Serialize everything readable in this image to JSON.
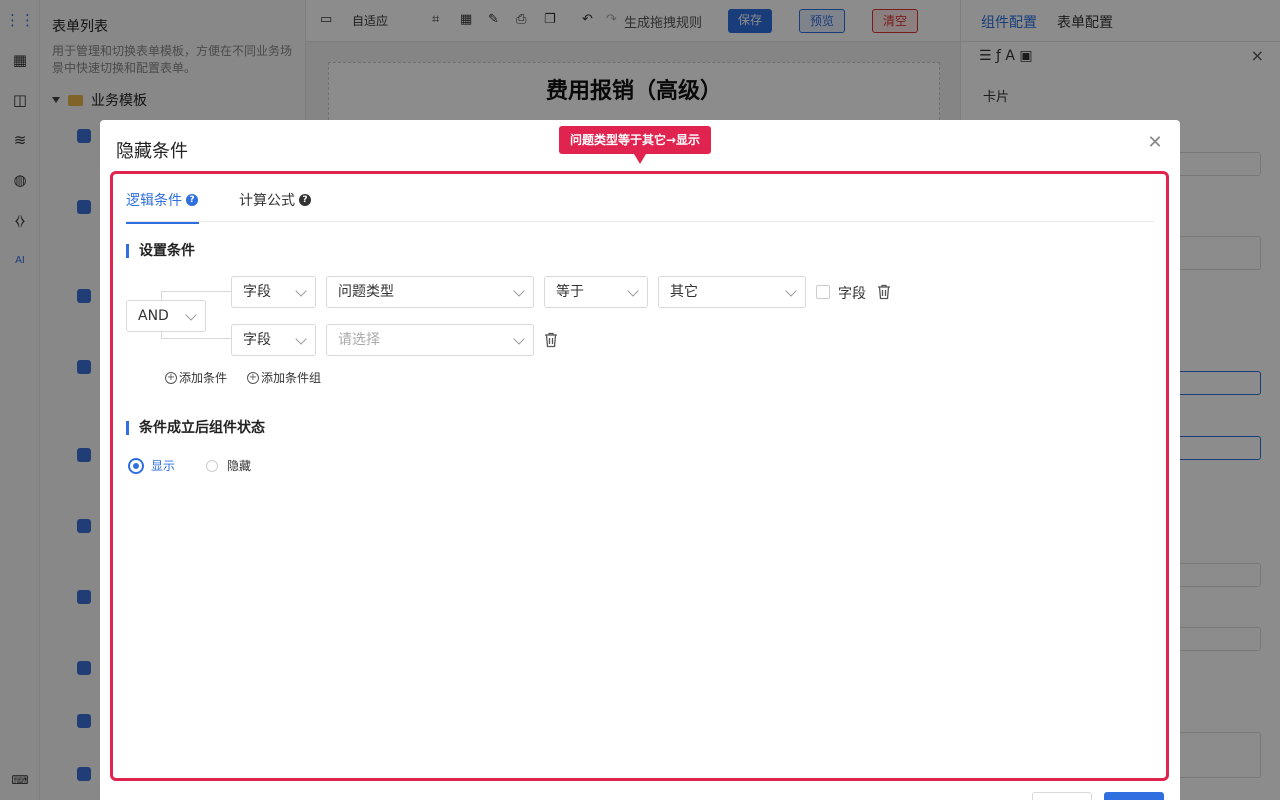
{
  "left_panel": {
    "title": "表单列表",
    "description": "用于管理和切换表单模板，方便在不同业务场景中快速切换和配置表单。",
    "folder": "业务模板"
  },
  "toolbar": {
    "adaptive": "自适应",
    "generate_rule": "生成拖拽规则",
    "save": "保存",
    "preview": "预览",
    "clear": "清空"
  },
  "canvas": {
    "form_title": "费用报销（高级）"
  },
  "right_panel": {
    "tab_component": "组件配置",
    "tab_form": "表单配置",
    "card_label": "卡片"
  },
  "modal": {
    "title": "隐藏条件",
    "callout": "问题类型等于其它→显示",
    "tabs": [
      {
        "label": "逻辑条件"
      },
      {
        "label": "计算公式"
      }
    ],
    "section_conditions": "设置条件",
    "logic": "AND",
    "rows": [
      {
        "type": "字段",
        "field": "问题类型",
        "operator": "等于",
        "value": "其它",
        "checkbox_label": "字段"
      },
      {
        "type": "字段",
        "field_placeholder": "请选择"
      }
    ],
    "add_condition": "添加条件",
    "add_group": "添加条件组",
    "section_state": "条件成立后组件状态",
    "state_options": [
      {
        "label": "显示",
        "selected": true
      },
      {
        "label": "隐藏",
        "selected": false
      }
    ]
  },
  "colors": {
    "accent": "#2f6fe0",
    "highlight": "#e0244f"
  }
}
